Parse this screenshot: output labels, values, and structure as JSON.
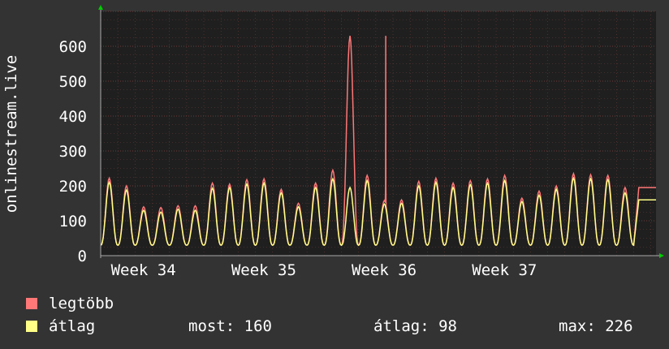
{
  "colors": {
    "background": "#333333",
    "plot_background": "#1f1f1f",
    "grid": "#6b3b3b",
    "axis": "#aaaaaa",
    "arrow": "#00cc00",
    "max_series": "#ff7777",
    "avg_series": "#ffff88"
  },
  "legend": {
    "max_label": "legtöbb",
    "avg_label": "átlag",
    "current": "most: 160",
    "average": "átlag: 98",
    "maximum": "max: 226"
  },
  "chart_data": {
    "type": "line",
    "ylabel": "onlinestream.live",
    "ylim": [
      0,
      700
    ],
    "yticks": [
      0,
      100,
      200,
      300,
      400,
      500,
      600
    ],
    "xlim": [
      0,
      32.3
    ],
    "xticks": [
      {
        "pos": 0.5,
        "label": "Week 34"
      },
      {
        "pos": 7.5,
        "label": "Week 35"
      },
      {
        "pos": 14.5,
        "label": "Week 36"
      },
      {
        "pos": 21.5,
        "label": "Week 37"
      }
    ],
    "grid": true,
    "series": [
      {
        "name": "legtöbb",
        "peaks": [
          222,
          200,
          140,
          138,
          143,
          143,
          208,
          205,
          218,
          220,
          190,
          150,
          208,
          245,
          630,
          230,
          158,
          160,
          213,
          222,
          208,
          215,
          220,
          230,
          165,
          185,
          200,
          235,
          232,
          230,
          195
        ],
        "spike": {
          "x": 16.58,
          "value": 630
        },
        "last": 195
      },
      {
        "name": "átlag",
        "peaks": [
          210,
          188,
          130,
          125,
          133,
          130,
          193,
          195,
          205,
          208,
          180,
          140,
          195,
          220,
          195,
          215,
          148,
          150,
          200,
          210,
          195,
          203,
          208,
          215,
          155,
          173,
          190,
          222,
          220,
          218,
          180
        ],
        "last": 160
      }
    ]
  }
}
